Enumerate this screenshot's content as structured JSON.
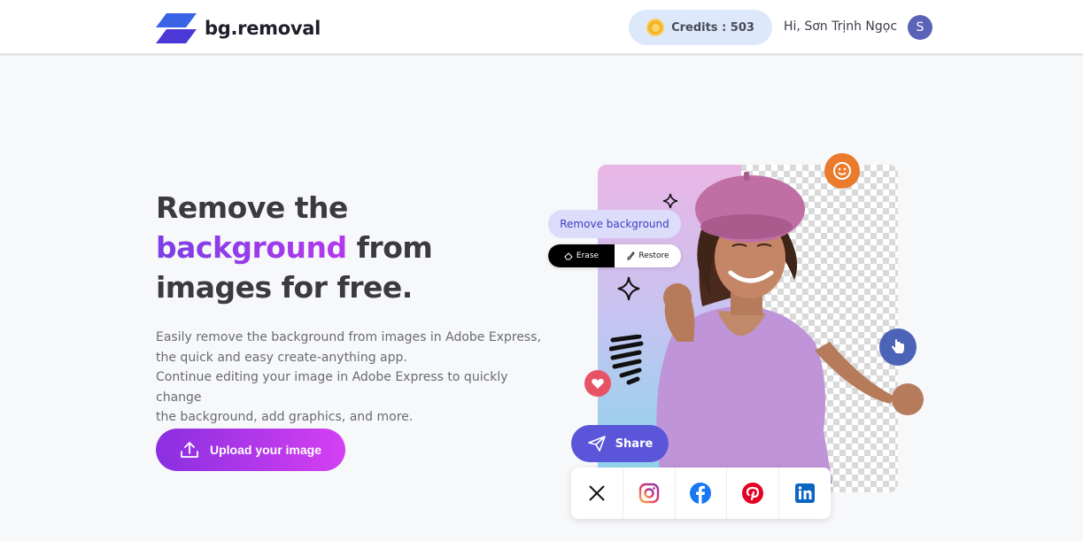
{
  "header": {
    "logo_text": "bg.removal",
    "credits_label": "Credits : 503",
    "greeting": "Hi, Sơn Trịnh Ngọc",
    "avatar_initial": "S"
  },
  "hero": {
    "headline_line1": "Remove the",
    "headline_accent": "background",
    "headline_rest": " from",
    "headline_line3": "images for free.",
    "description_line1": "Easily remove the background from images in Adobe Express,",
    "description_line2": "the quick and easy create-anything app.",
    "description_line3": "Continue editing your image in Adobe Express to quickly change",
    "description_line4": "the background, add graphics, and more.",
    "upload_label": "Upload your image"
  },
  "illustration": {
    "remove_bg_label": "Remove background",
    "erase_label": "Erase",
    "restore_label": "Restore",
    "share_label": "Share",
    "social_icons": [
      "x-icon",
      "instagram-icon",
      "facebook-icon",
      "pinterest-icon",
      "linkedin-icon"
    ]
  },
  "colors": {
    "accent_purple": "#8a2fe0",
    "accent_pink": "#d440f2",
    "credits_bg": "#dde8fb",
    "share_bg": "#5b56d9",
    "avatar_bg": "#5b63b7"
  }
}
